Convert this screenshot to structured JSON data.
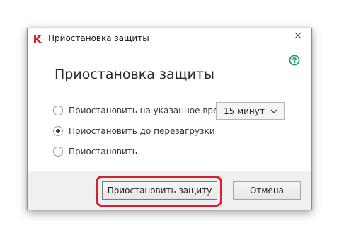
{
  "window": {
    "title": "Приостановка защиты",
    "app_icon": "kaspersky-logo-icon",
    "close_icon": "close-icon"
  },
  "help": {
    "icon": "help-icon"
  },
  "heading": "Приостановка защиты",
  "options": [
    {
      "label": "Приостановить на указанное время",
      "checked": false
    },
    {
      "label": "Приостановить до перезагрузки",
      "checked": true
    },
    {
      "label": "Приостановить",
      "checked": false
    }
  ],
  "duration_select": {
    "value": "15 минут",
    "icon": "chevron-down-icon"
  },
  "buttons": {
    "pause_label": "Приостановить защиту",
    "cancel_label": "Отмена"
  },
  "colors": {
    "brand": "#d7212e",
    "help_accent": "#1f9a73",
    "highlight": "#d7212e"
  }
}
